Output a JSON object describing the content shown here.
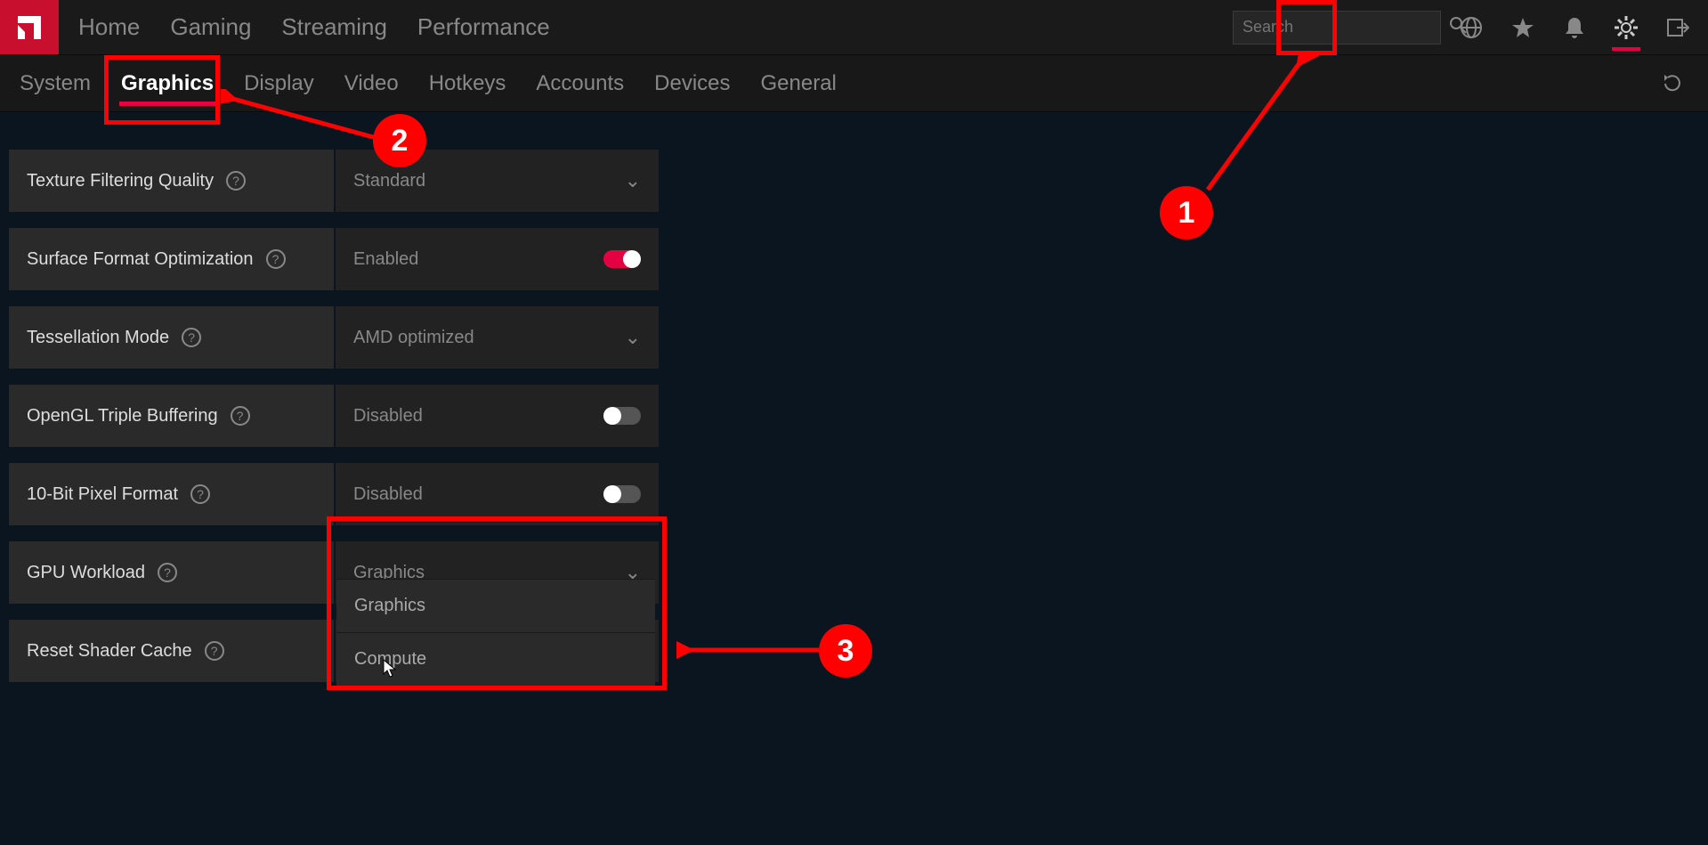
{
  "topnav": {
    "items": [
      "Home",
      "Gaming",
      "Streaming",
      "Performance"
    ],
    "active": 0
  },
  "search": {
    "placeholder": "Search"
  },
  "subnav": {
    "items": [
      "System",
      "Graphics",
      "Display",
      "Video",
      "Hotkeys",
      "Accounts",
      "Devices",
      "General"
    ],
    "active": 1
  },
  "settings": [
    {
      "label": "Texture Filtering Quality",
      "type": "select",
      "value": "Standard"
    },
    {
      "label": "Surface Format Optimization",
      "type": "toggle",
      "value": "Enabled",
      "on": true
    },
    {
      "label": "Tessellation Mode",
      "type": "select",
      "value": "AMD optimized"
    },
    {
      "label": "OpenGL Triple Buffering",
      "type": "toggle",
      "value": "Disabled",
      "on": false
    },
    {
      "label": "10-Bit Pixel Format",
      "type": "toggle",
      "value": "Disabled",
      "on": false
    },
    {
      "label": "GPU Workload",
      "type": "select",
      "value": "Graphics"
    },
    {
      "label": "Reset Shader Cache",
      "type": "action",
      "value": ""
    }
  ],
  "gpu_workload_options": [
    "Graphics",
    "Compute"
  ],
  "callouts": {
    "c1": "1",
    "c2": "2",
    "c3": "3"
  }
}
